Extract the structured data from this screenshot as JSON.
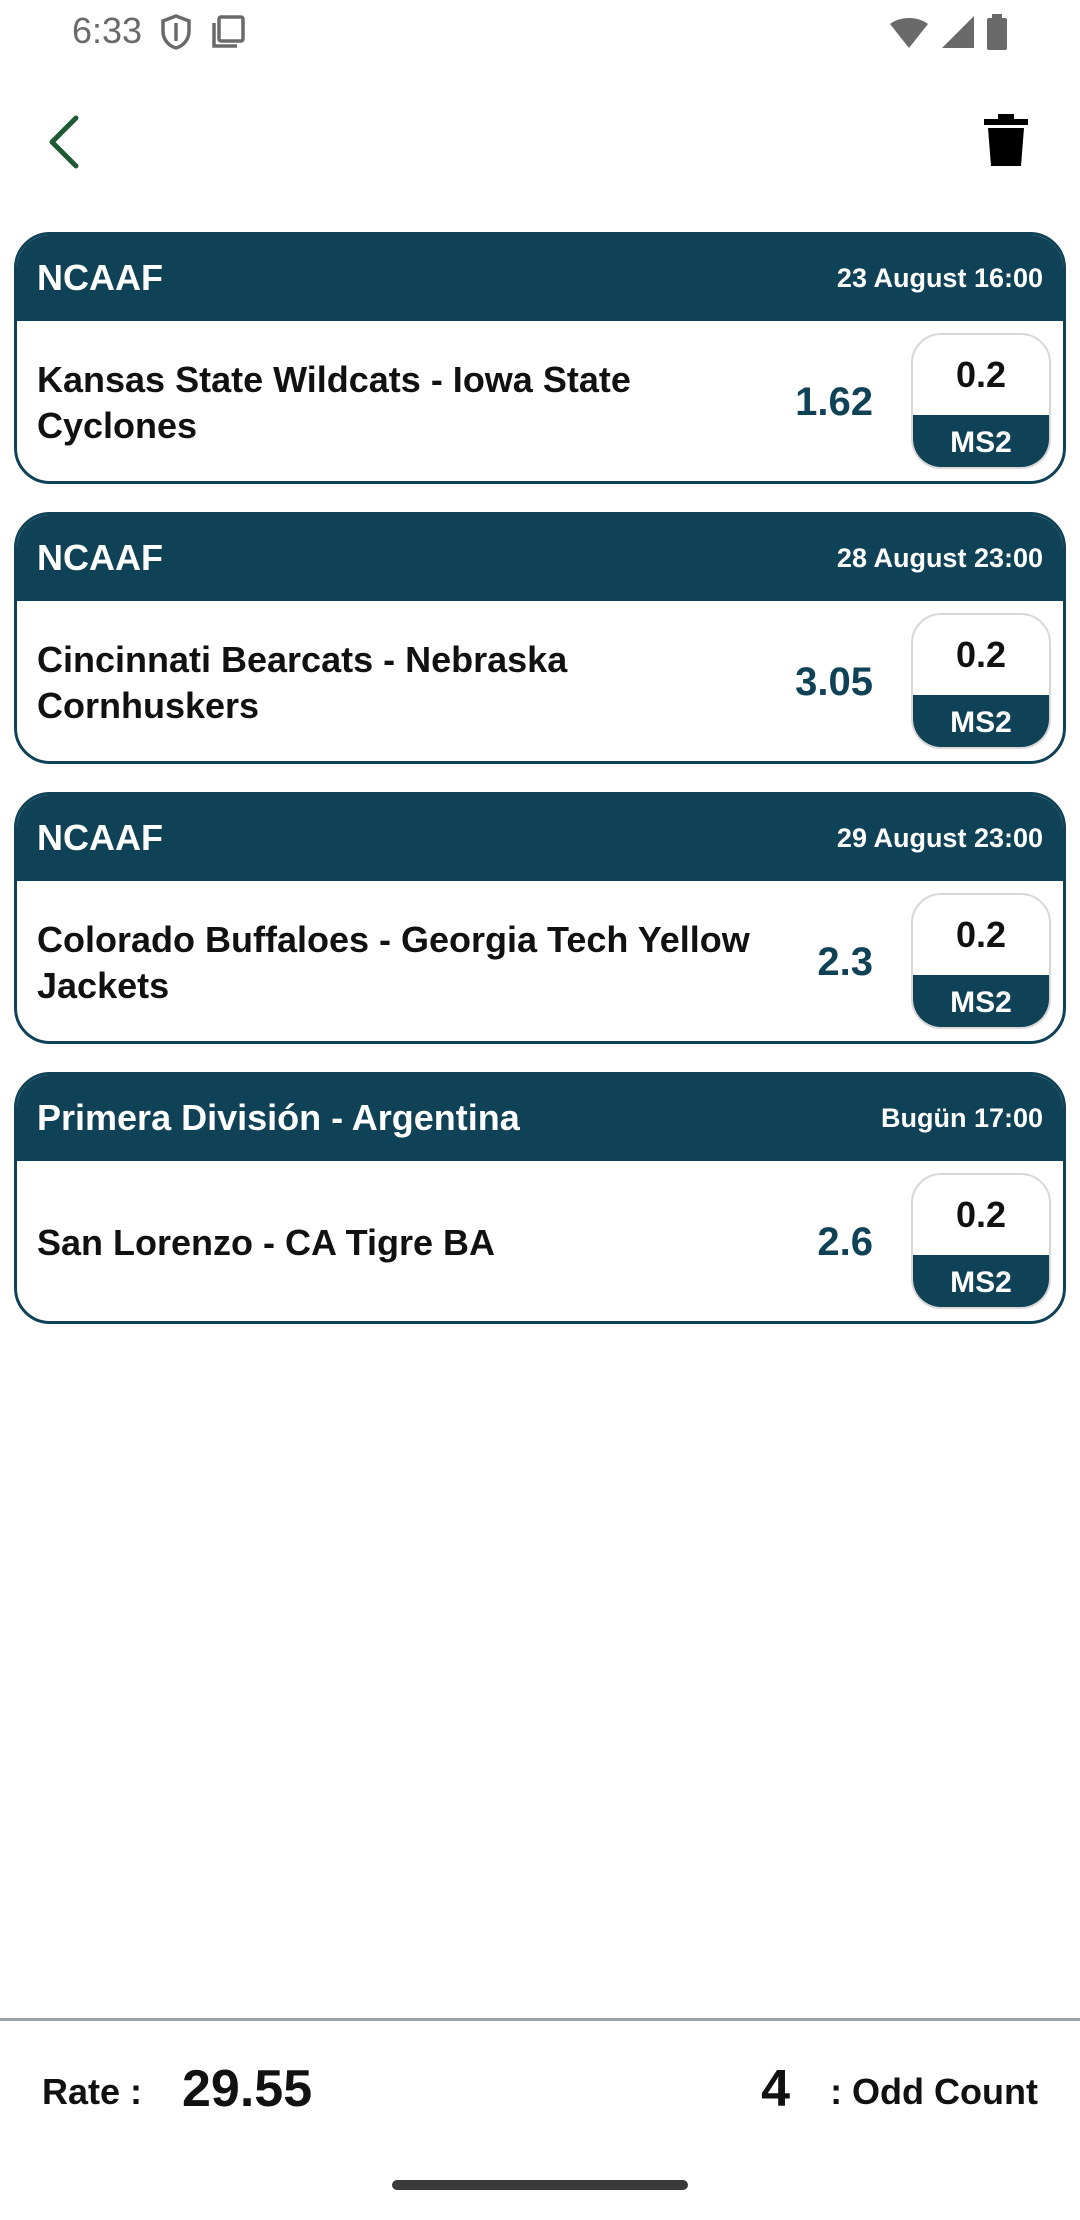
{
  "status_bar": {
    "time": "6:33",
    "icons": [
      "shield-icon",
      "screen-icon",
      "wifi-icon",
      "signal-icon",
      "battery-icon"
    ]
  },
  "toolbar": {
    "back_icon": "chevron-left-icon",
    "delete_icon": "trash-icon"
  },
  "colors": {
    "primary": "#0f4157",
    "back_arrow": "#1f5a34",
    "background": "#ffffff"
  },
  "bets": [
    {
      "league": "NCAAF",
      "date": "23 August 16:00",
      "match": "Kansas State Wildcats - Iowa State Cyclones",
      "odd": "1.62",
      "stake": "0.2",
      "bet_type": "MS2"
    },
    {
      "league": "NCAAF",
      "date": "28 August 23:00",
      "match": "Cincinnati Bearcats - Nebraska Cornhuskers",
      "odd": "3.05",
      "stake": "0.2",
      "bet_type": "MS2"
    },
    {
      "league": "NCAAF",
      "date": "29 August 23:00",
      "match": "Colorado Buffaloes - Georgia Tech Yellow Jackets",
      "odd": "2.3",
      "stake": "0.2",
      "bet_type": "MS2"
    },
    {
      "league": "Primera División - Argentina",
      "date": "Bugün 17:00",
      "match": "San Lorenzo - CA Tigre BA",
      "odd": "2.6",
      "stake": "0.2",
      "bet_type": "MS2"
    }
  ],
  "summary": {
    "rate_label": "Rate :",
    "rate_value": "29.55",
    "odd_count_value": "4",
    "odd_count_label": ": Odd Count"
  }
}
